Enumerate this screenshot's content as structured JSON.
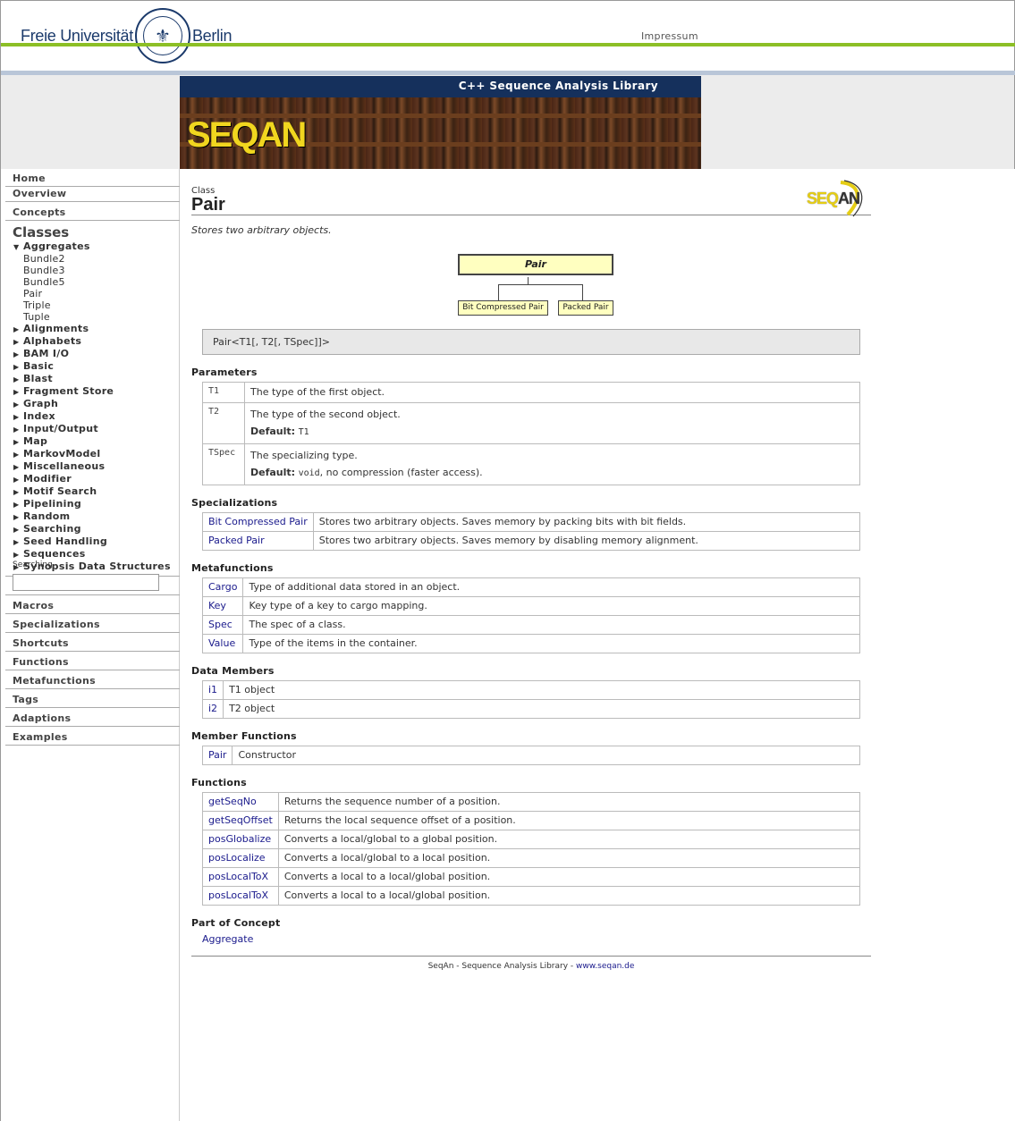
{
  "header": {
    "university_left": "Freie Universität",
    "university_right": "Berlin",
    "impressum": "Impressum"
  },
  "banner": {
    "title": "C++ Sequence Analysis Library",
    "logo_text": "SEQAN"
  },
  "sidebar": {
    "top_items": [
      {
        "label": "Home"
      },
      {
        "label": "Overview"
      },
      {
        "label": "Concepts"
      }
    ],
    "classes_heading": "Classes",
    "aggregates": {
      "label": "Aggregates",
      "children": [
        "Bundle2",
        "Bundle3",
        "Bundle5",
        "Pair",
        "Triple",
        "Tuple"
      ]
    },
    "class_groups": [
      "Alignments",
      "Alphabets",
      "BAM I/O",
      "Basic",
      "Blast",
      "Fragment Store",
      "Graph",
      "Index",
      "Input/Output",
      "Map",
      "MarkovModel",
      "Miscellaneous",
      "Modifier",
      "Motif Search",
      "Pipelining",
      "Random",
      "Searching",
      "Seed Handling",
      "Sequences",
      "Synopsis Data Structures"
    ],
    "bottom_items": [
      {
        "label": "Enums"
      },
      {
        "label": "Macros"
      },
      {
        "label": "Specializations"
      },
      {
        "label": "Shortcuts"
      },
      {
        "label": "Functions"
      },
      {
        "label": "Metafunctions"
      },
      {
        "label": "Tags"
      },
      {
        "label": "Adaptions"
      },
      {
        "label": "Examples"
      }
    ],
    "search_label": "Searching",
    "search_value": ""
  },
  "main": {
    "kind": "Class",
    "title": "Pair",
    "description": "Stores two arbitrary objects.",
    "diagram": {
      "main_box": "Pair",
      "children": [
        "Bit Compressed Pair",
        "Packed Pair"
      ]
    },
    "signature": "Pair<T1[, T2[, TSpec]]>",
    "parameters_heading": "Parameters",
    "parameters": [
      {
        "name": "T1",
        "desc": "The type of the first object.",
        "default_label": "",
        "default_value": "",
        "default_rest": ""
      },
      {
        "name": "T2",
        "desc": "The type of the second object.",
        "default_label": "Default:",
        "default_value": "T1",
        "default_rest": ""
      },
      {
        "name": "TSpec",
        "desc": "The specializing type.",
        "default_label": "Default:",
        "default_value": "void",
        "default_rest": ", no compression (faster access)."
      }
    ],
    "specializations_heading": "Specializations",
    "specializations": [
      {
        "name": "Bit Compressed Pair",
        "desc": "Stores two arbitrary objects. Saves memory by packing bits with bit fields."
      },
      {
        "name": "Packed Pair",
        "desc": "Stores two arbitrary objects. Saves memory by disabling memory alignment."
      }
    ],
    "metafunctions_heading": "Metafunctions",
    "metafunctions": [
      {
        "name": "Cargo",
        "desc": "Type of additional data stored in an object."
      },
      {
        "name": "Key",
        "desc": "Key type of a key to cargo mapping."
      },
      {
        "name": "Spec",
        "desc": "The spec of a class."
      },
      {
        "name": "Value",
        "desc": "Type of the items in the container."
      }
    ],
    "data_members_heading": "Data Members",
    "data_members": [
      {
        "name": "i1",
        "desc": "T1 object"
      },
      {
        "name": "i2",
        "desc": "T2 object"
      }
    ],
    "member_functions_heading": "Member Functions",
    "member_functions": [
      {
        "name": "Pair",
        "desc": "Constructor"
      }
    ],
    "functions_heading": "Functions",
    "functions": [
      {
        "name": "getSeqNo",
        "desc": "Returns the sequence number of a position."
      },
      {
        "name": "getSeqOffset",
        "desc": "Returns the local sequence offset of a position."
      },
      {
        "name": "posGlobalize",
        "desc": "Converts a local/global to a global position."
      },
      {
        "name": "posLocalize",
        "desc": "Converts a local/global to a local position."
      },
      {
        "name": "posLocalToX",
        "desc": "Converts a local to a local/global position."
      },
      {
        "name": "posLocalToX",
        "desc": "Converts a local to a local/global position."
      }
    ],
    "concept_heading": "Part of Concept",
    "concept": "Aggregate"
  },
  "footer": {
    "text": "SeqAn - Sequence Analysis Library - ",
    "link": "www.seqan.de"
  },
  "colors": {
    "green_rule": "#8cbf26",
    "blue_rule": "#b9c6d8",
    "banner_bar": "#15305c",
    "link": "#1a1a8c",
    "diagram_fill": "#ffffc0"
  }
}
